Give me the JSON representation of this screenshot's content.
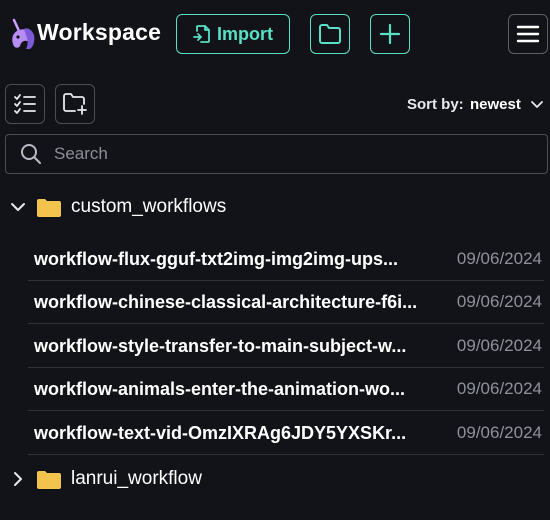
{
  "header": {
    "title": "Workspace",
    "import_label": "Import",
    "accent_color": "#58e0c5"
  },
  "toolbar": {
    "sort_label": "Sort by:",
    "sort_value": "newest"
  },
  "search": {
    "placeholder": "Search"
  },
  "tree": {
    "folders": [
      {
        "name": "custom_workflows",
        "expanded": true,
        "items": [
          {
            "name": "workflow-flux-gguf-txt2img-img2img-ups...",
            "date": "09/06/2024"
          },
          {
            "name": "workflow-chinese-classical-architecture-f6i...",
            "date": "09/06/2024"
          },
          {
            "name": "workflow-style-transfer-to-main-subject-w...",
            "date": "09/06/2024"
          },
          {
            "name": "workflow-animals-enter-the-animation-wo...",
            "date": "09/06/2024"
          },
          {
            "name": "workflow-text-vid-OmzIXRAg6JDY5YXSKr...",
            "date": "09/06/2024"
          }
        ]
      },
      {
        "name": "lanrui_workflow",
        "expanded": false
      }
    ]
  }
}
